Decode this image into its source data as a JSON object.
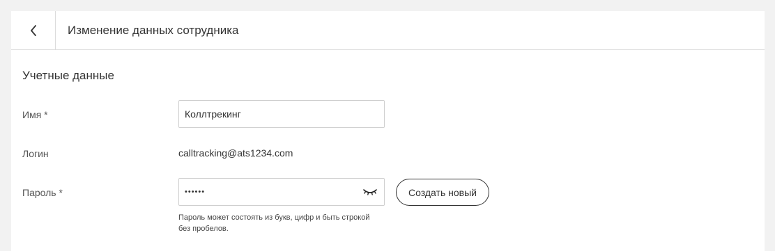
{
  "header": {
    "back_icon": "chevron-left-icon",
    "title": "Изменение данных сотрудника"
  },
  "section": {
    "title": "Учетные данные"
  },
  "form": {
    "name": {
      "label": "Имя *",
      "value": "Коллтрекинг"
    },
    "login": {
      "label": "Логин",
      "value": "calltracking@ats1234.com"
    },
    "password": {
      "label": "Пароль *",
      "value": "••••••",
      "toggle_icon": "eye-closed-icon",
      "hint": "Пароль может состоять из букв, цифр и быть строкой без пробелов.",
      "generate_label": "Создать новый"
    }
  },
  "colors": {
    "background": "#f2f2f2",
    "card": "#ffffff",
    "border": "#dcdcdc",
    "text": "#333333"
  }
}
